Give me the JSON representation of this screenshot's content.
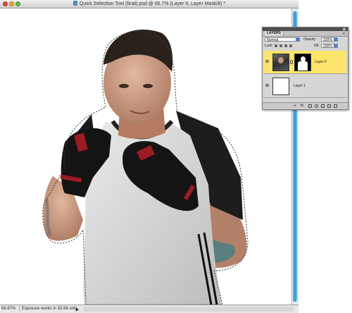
{
  "window": {
    "title": "Quick Selection Tool (final).psd @ 66.7% (Layer 0, Layer Mask/8) *"
  },
  "statusbar": {
    "zoom": "66.67%",
    "message": "Exposure works in 32-bit only"
  },
  "layers_panel": {
    "tab": "LAYERS",
    "blend_mode": "Normal",
    "opacity_label": "Opacity:",
    "opacity_value": "100%",
    "lock_label": "Lock:",
    "fill_label": "Fill:",
    "fill_value": "100%",
    "layers": [
      {
        "name": "Layer 0",
        "selected": true,
        "has_mask": true
      },
      {
        "name": "Layer 1",
        "selected": false,
        "has_mask": false
      }
    ],
    "bottom_link": "∞",
    "bottom_fx": "fx"
  },
  "colors": {
    "selected_layer": "#fde46a",
    "scroll_thumb": "#2a92d2",
    "shirt_dark": "#1c1c1c",
    "shirt_light": "#d9d9d9"
  }
}
